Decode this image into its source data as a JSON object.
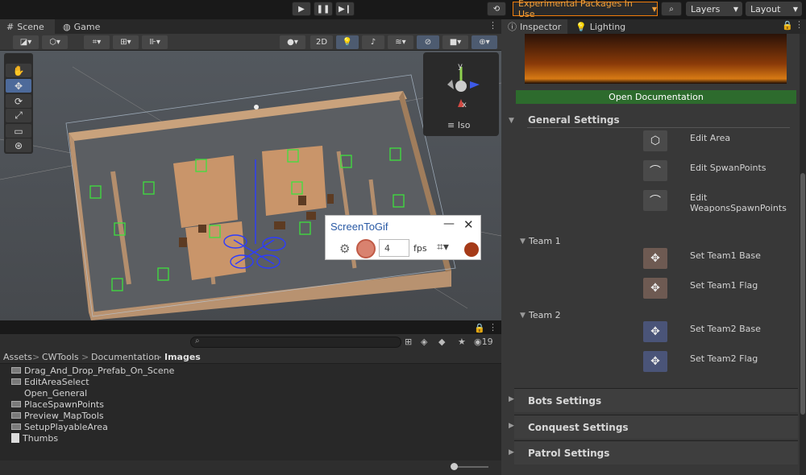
{
  "toolbar": {
    "play_icon": "play-icon",
    "pause_icon": "pause-icon",
    "step_icon": "step-icon",
    "experimental": "Experimental Packages In Use",
    "layers": "Layers",
    "layout": "Layout"
  },
  "scene_tabs": {
    "scene": "Scene",
    "game": "Game"
  },
  "scene_toolbar": {
    "mode_2d": "2D"
  },
  "gizmo": {
    "y": "y",
    "x": "x",
    "projection": "Iso"
  },
  "screentogif": {
    "title": "ScreenToGif",
    "fps_value": "4",
    "fps_label": "fps"
  },
  "project": {
    "search_placeholder": "",
    "hidden_count": "19",
    "breadcrumb": [
      "Assets",
      "CWTools",
      "Documentation",
      "Images"
    ],
    "files": [
      {
        "name": "Drag_And_Drop_Prefab_On_Scene",
        "icon": "image-icon"
      },
      {
        "name": "EditAreaSelect",
        "icon": "image-icon"
      },
      {
        "name": "Open_General",
        "icon": "none"
      },
      {
        "name": "PlaceSpawnPoints",
        "icon": "image-icon"
      },
      {
        "name": "Preview_MapTools",
        "icon": "image-icon"
      },
      {
        "name": "SetupPlayableArea",
        "icon": "image-icon"
      },
      {
        "name": "Thumbs",
        "icon": "file-icon"
      }
    ]
  },
  "inspector": {
    "tabs": {
      "inspector": "Inspector",
      "lighting": "Lighting"
    },
    "open_doc": "Open Documentation",
    "general_settings": "General Settings",
    "edit_area": "Edit Area",
    "edit_spawn": "Edit SpwanPoints",
    "edit_weapons": "Edit WeaponsSpawnPoints",
    "team1": "Team 1",
    "team1_base": "Set Team1 Base",
    "team1_flag": "Set Team1 Flag",
    "team2": "Team 2",
    "team2_base": "Set Team2 Base",
    "team2_flag": "Set Team2 Flag",
    "bots_settings": "Bots Settings",
    "conquest_settings": "Conquest Settings",
    "patrol_settings": "Patrol Settings"
  },
  "colors": {
    "accent_orange": "#f07c0a",
    "doc_green": "#2d6b2d",
    "team1": "#6e5a52",
    "team2": "#4a5478"
  }
}
